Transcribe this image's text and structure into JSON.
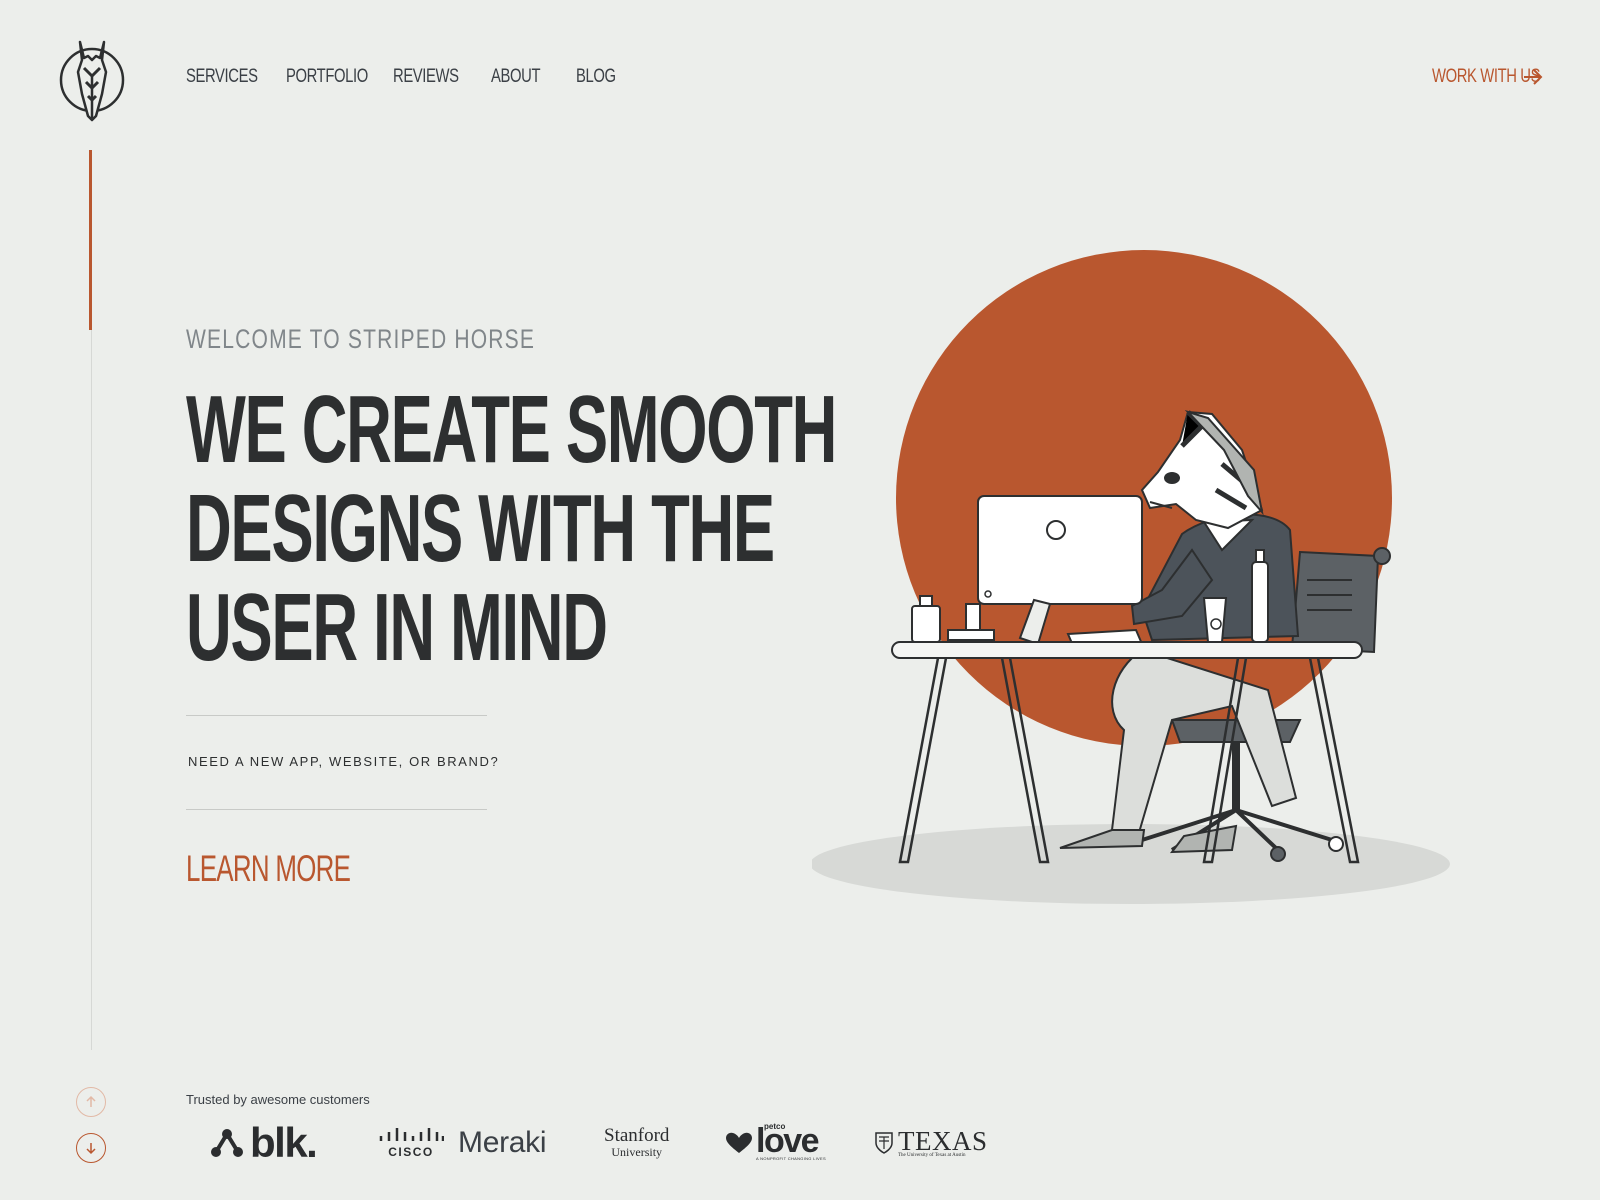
{
  "brand": {
    "accent_color": "#b9572f",
    "text_color": "#2d2f30",
    "background": "#eceeeb"
  },
  "header": {
    "logo": "striped-horse-logo",
    "nav": [
      {
        "label": "SERVICES"
      },
      {
        "label": "PORTFOLIO"
      },
      {
        "label": "REVIEWS"
      },
      {
        "label": "ABOUT"
      },
      {
        "label": "BLOG"
      }
    ],
    "cta": {
      "label": "WORK WITH US",
      "icon": "arrow-right-icon"
    }
  },
  "hero": {
    "eyebrow": "WELCOME TO STRIPED HORSE",
    "headline_lines": [
      "WE CREATE SMOOTH",
      "DESIGNS WITH THE",
      "USER IN MIND"
    ],
    "question": "NEED A NEW APP, WEBSITE, OR BRAND?",
    "learn_more": "LEARN MORE",
    "illustration": "zebra-at-desk-illustration"
  },
  "scroll": {
    "up_icon": "arrow-up-icon",
    "down_icon": "arrow-down-icon"
  },
  "clients": {
    "heading": "Trusted by awesome customers",
    "logos": [
      {
        "name": "blk.",
        "mark": "™",
        "reg": "®"
      },
      {
        "name": "Meraki",
        "parent": "CISCO"
      },
      {
        "name": "Stanford",
        "sub": "University"
      },
      {
        "name": "love",
        "brand": "petco",
        "sub": "A NONPROFIT CHANGING LIVES"
      },
      {
        "name": "TEXAS",
        "sub": "The University of Texas at Austin"
      }
    ]
  }
}
